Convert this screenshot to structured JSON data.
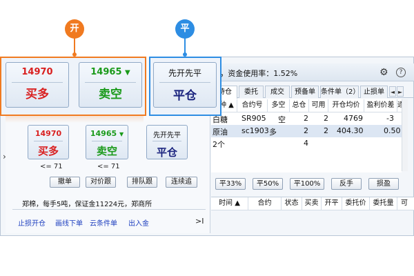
{
  "callouts": {
    "open": "开",
    "flat": "平"
  },
  "colors": {
    "orange": "#f07a20",
    "blue": "#2d8de3",
    "red": "#d92020",
    "green": "#1a9a1a"
  },
  "big_buttons": {
    "buy_long": {
      "price": "14970",
      "label": "买多"
    },
    "sell_short": {
      "price": "14965",
      "arrow": "▼",
      "label": "卖空"
    },
    "close": {
      "top_label": "先开先平",
      "label": "平仓"
    }
  },
  "small_buttons": {
    "buy_long": {
      "price": "14970",
      "label": "买多",
      "qty": "<= 71"
    },
    "sell_short": {
      "price": "14965",
      "arrow": "▼",
      "label": "卖空",
      "qty": "<= 71"
    },
    "close": {
      "top_label": "先开先平",
      "label": "平仓"
    }
  },
  "order_buttons": [
    "撤单",
    "对价跟",
    "排队跟",
    "连续追"
  ],
  "info_line": "郑棉，每手5吨，保证金11224元，郑商所",
  "links": [
    "止损开仓",
    "画线下单",
    "云条件单",
    "出入金"
  ],
  "pager": ">I",
  "expand_arrow": "›",
  "title": "I，资金使用率：1.52%",
  "icons": {
    "settings": "gear-icon",
    "help": "help-icon"
  },
  "tabs": [
    "持仓",
    "委托",
    "成交",
    "预备单",
    "条件单（2）",
    "止损单"
  ],
  "tab_arrows": [
    "◄",
    "►"
  ],
  "position_headers": [
    "品种 ▲",
    "合约号",
    "多空",
    "总仓",
    "可用",
    "开仓均价",
    "盈利价差",
    "逐"
  ],
  "position_rows": [
    {
      "name": "白糖",
      "contract": "SR905",
      "side": "空",
      "total": "2",
      "avail": "2",
      "avg": "4769",
      "diff": "-3"
    },
    {
      "name": "原油",
      "contract": "sc1903",
      "side": "多",
      "total": "2",
      "avail": "2",
      "avg": "404.30",
      "diff": "0.50"
    }
  ],
  "summary_row": {
    "name": "2个",
    "total": "4"
  },
  "action_buttons": [
    "平33%",
    "平50%",
    "平100%",
    "反手",
    "损盈"
  ],
  "order_headers": [
    "时间 ▲",
    "合约",
    "状态",
    "买卖",
    "开平",
    "委托价",
    "委托量",
    "可"
  ]
}
